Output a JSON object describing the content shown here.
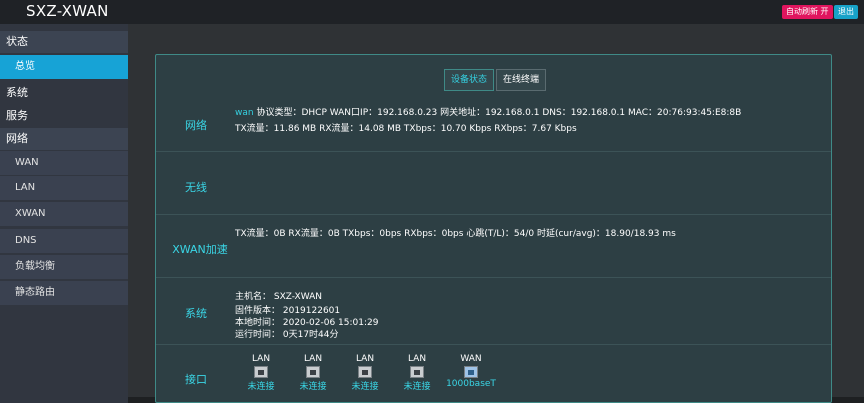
{
  "app": {
    "title": "SXZ-XWAN",
    "auto_refresh_label": "自动刷新 开",
    "logout_label": "退出"
  },
  "sidebar": {
    "sections": [
      {
        "label": "状态"
      },
      {
        "label": "系统"
      },
      {
        "label": "服务"
      },
      {
        "label": "网络"
      }
    ],
    "status_items": [
      {
        "label": "总览"
      }
    ],
    "network_items": [
      {
        "label": "WAN"
      },
      {
        "label": "LAN"
      },
      {
        "label": "XWAN"
      },
      {
        "label": "DNS"
      },
      {
        "label": "负载均衡"
      },
      {
        "label": "静态路由"
      }
    ]
  },
  "tabs": [
    {
      "label": "设备状态"
    },
    {
      "label": "在线终端"
    }
  ],
  "network": {
    "label": "网络",
    "iface": "wan",
    "line1": "协议类型：DHCP    WAN口IP：192.168.0.23    网关地址：192.168.0.1    DNS：192.168.0.1    MAC：20:76:93:45:E8:8B",
    "line2": "TX流量：11.86 MB    RX流量：14.08 MB    TXbps：10.70 Kbps    RXbps：7.67 Kbps"
  },
  "wireless": {
    "label": "无线"
  },
  "xwan": {
    "label": "XWAN加速",
    "line1": "TX流量：0B    RX流量：0B    TXbps：0bps    RXbps：0bps    心跳(T/L)：54/0    时延(cur/avg)：18.90/18.93 ms"
  },
  "system": {
    "label": "系统",
    "hostname": "主机名：  SXZ-XWAN",
    "firmware": "固件版本：  2019122601",
    "localtime": "本地时间：  2020-02-06 15:01:29",
    "uptime": "运行时间：  0天17时44分"
  },
  "interfaces": {
    "label": "接口",
    "ports": [
      {
        "name": "LAN",
        "status": "未连接"
      },
      {
        "name": "LAN",
        "status": "未连接"
      },
      {
        "name": "LAN",
        "status": "未连接"
      },
      {
        "name": "LAN",
        "status": "未连接"
      },
      {
        "name": "WAN",
        "status": "1000baseT"
      }
    ]
  },
  "colors": {
    "accent": "#35d0e0",
    "active_nav": "#17a3d6",
    "refresh_button": "#e0155e",
    "logout_button": "#17a2c8"
  }
}
